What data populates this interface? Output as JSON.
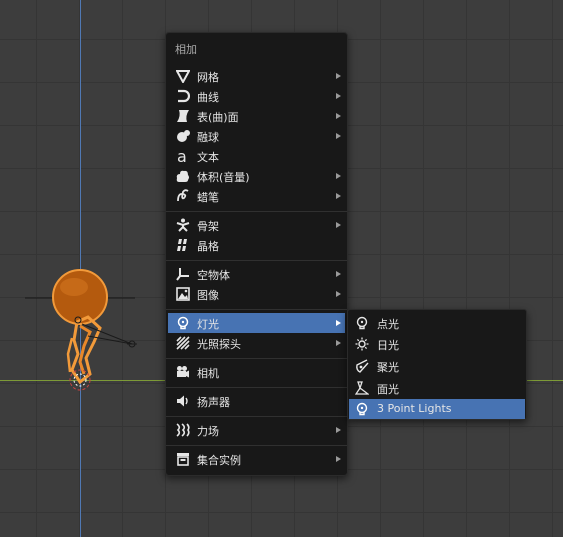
{
  "menu": {
    "title": "相加",
    "items": [
      {
        "label": "网格",
        "icon": "mesh-icon",
        "submenu": true
      },
      {
        "label": "曲线",
        "icon": "curve-icon",
        "submenu": true
      },
      {
        "label": "表(曲)面",
        "icon": "surface-icon",
        "submenu": true
      },
      {
        "label": "融球",
        "icon": "metaball-icon",
        "submenu": true
      },
      {
        "label": "文本",
        "icon": "text-icon",
        "submenu": false
      },
      {
        "label": "体积(音量)",
        "icon": "volume-icon",
        "submenu": true
      },
      {
        "label": "蜡笔",
        "icon": "grease-pencil-icon",
        "submenu": true
      },
      {
        "label": "骨架",
        "icon": "armature-icon",
        "submenu": true
      },
      {
        "label": "晶格",
        "icon": "lattice-icon",
        "submenu": false
      },
      {
        "label": "空物体",
        "icon": "empty-icon",
        "submenu": true
      },
      {
        "label": "图像",
        "icon": "image-icon",
        "submenu": true
      },
      {
        "label": "灯光",
        "icon": "light-icon",
        "submenu": true,
        "highlighted": true
      },
      {
        "label": "光照探头",
        "icon": "light-probe-icon",
        "submenu": true
      },
      {
        "label": "相机",
        "icon": "camera-icon",
        "submenu": false
      },
      {
        "label": "扬声器",
        "icon": "speaker-icon",
        "submenu": false
      },
      {
        "label": "力场",
        "icon": "force-field-icon",
        "submenu": true
      },
      {
        "label": "集合实例",
        "icon": "collection-instance-icon",
        "submenu": true
      }
    ]
  },
  "light_submenu": {
    "items": [
      {
        "label": "点光",
        "icon": "point-light-icon"
      },
      {
        "label": "日光",
        "icon": "sun-light-icon"
      },
      {
        "label": "聚光",
        "icon": "spot-light-icon"
      },
      {
        "label": "面光",
        "icon": "area-light-icon"
      },
      {
        "label": "3 Point Lights",
        "icon": "three-point-lights-icon",
        "highlighted": true
      }
    ]
  },
  "colors": {
    "highlight": "#4773b3",
    "menu_bg": "#181818",
    "viewport_bg": "#3d3d3d",
    "axis_y": "#5079b4",
    "axis_x": "#7d9a37",
    "model_orange": "#e8882a"
  }
}
